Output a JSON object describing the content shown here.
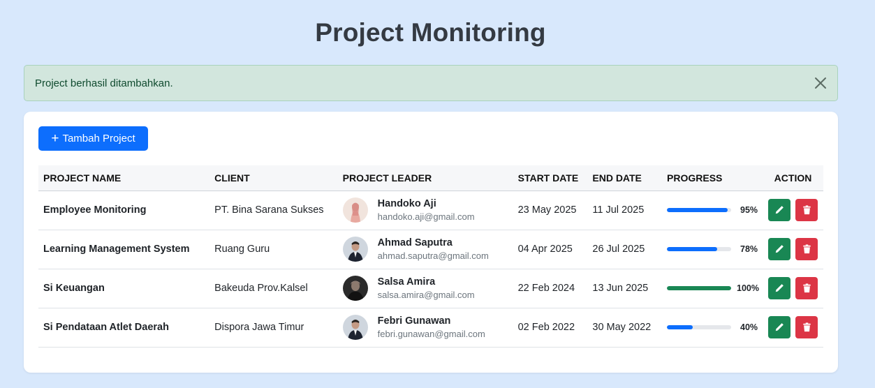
{
  "header": {
    "title": "Project Monitoring"
  },
  "alert": {
    "message": "Project berhasil ditambahkan.",
    "close_icon": "close-icon"
  },
  "toolbar": {
    "add_label": "Tambah Project",
    "add_icon": "plus-icon"
  },
  "table": {
    "columns": [
      "PROJECT NAME",
      "CLIENT",
      "PROJECT LEADER",
      "START DATE",
      "END DATE",
      "PROGRESS",
      "ACTION"
    ],
    "rows": [
      {
        "project": "Employee Monitoring",
        "client": "PT. Bina Sarana Sukses",
        "leader_name": "Handoko Aji",
        "leader_email": "handoko.aji@gmail.com",
        "start": "23 May 2025",
        "end": "11 Jul 2025",
        "progress": 95,
        "progress_label": "95%",
        "progress_color": "#0d6efd"
      },
      {
        "project": "Learning Management System",
        "client": "Ruang Guru",
        "leader_name": "Ahmad Saputra",
        "leader_email": "ahmad.saputra@gmail.com",
        "start": "04 Apr 2025",
        "end": "26 Jul 2025",
        "progress": 78,
        "progress_label": "78%",
        "progress_color": "#0d6efd"
      },
      {
        "project": "Si Keuangan",
        "client": "Bakeuda Prov.Kalsel",
        "leader_name": "Salsa Amira",
        "leader_email": "salsa.amira@gmail.com",
        "start": "22 Feb 2024",
        "end": "13 Jun 2025",
        "progress": 100,
        "progress_label": "100%",
        "progress_color": "#198754"
      },
      {
        "project": "Si Pendataan Atlet Daerah",
        "client": "Dispora Jawa Timur",
        "leader_name": "Febri Gunawan",
        "leader_email": "febri.gunawan@gmail.com",
        "start": "02 Feb 2022",
        "end": "30 May 2022",
        "progress": 40,
        "progress_label": "40%",
        "progress_color": "#0d6efd"
      }
    ]
  },
  "colors": {
    "background": "#d8e8fc",
    "primary": "#0d6efd",
    "success": "#198754",
    "danger": "#dc3545",
    "alert_bg": "#d2e6dd"
  }
}
